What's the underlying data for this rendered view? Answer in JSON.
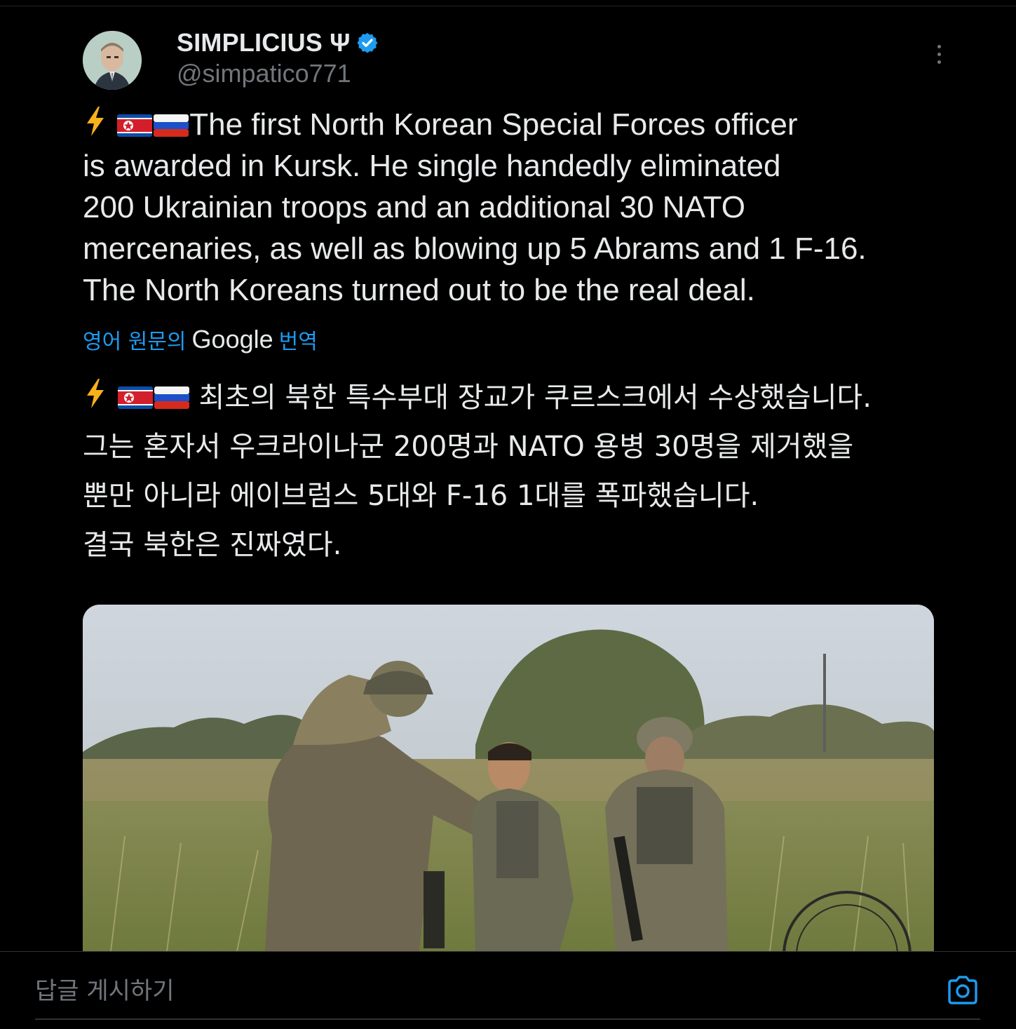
{
  "author": {
    "display_name": "SIMPLICIUS Ψ",
    "handle": "@simpatico771",
    "verified_color": "#1d9bf0"
  },
  "tweet": {
    "lines": [
      "The first North Korean Special Forces officer",
      "is awarded in Kursk. He single handedly eliminated",
      "200 Ukrainian troops and an additional 30 NATO",
      "mercenaries, as well as blowing up 5 Abrams and 1 F-16.",
      "The North Koreans turned out to be the real deal."
    ]
  },
  "translation": {
    "prefix": "영어 원문의",
    "google": "Google",
    "suffix": "번역",
    "lines": [
      "최초의 북한 특수부대 장교가 쿠르스크에서 수상했습니다.",
      "그는 혼자서 우크라이나군 200명과 NATO 용병 30명을 제거했을",
      "뿐만 아니라 에이브럼스 5대와 F-16 1대를 폭파했습니다.",
      "결국 북한은 진짜였다."
    ]
  },
  "icons": {
    "lightning": "lightning-icon",
    "flag_nk": "north-korea-flag-icon",
    "flag_ru": "russia-flag-icon",
    "more": "more-options-icon",
    "camera": "camera-icon"
  },
  "reply": {
    "placeholder": "답글 게시하기"
  },
  "colors": {
    "background": "#000000",
    "text": "#e7e9ea",
    "secondary": "#71767b",
    "accent": "#1d9bf0"
  }
}
